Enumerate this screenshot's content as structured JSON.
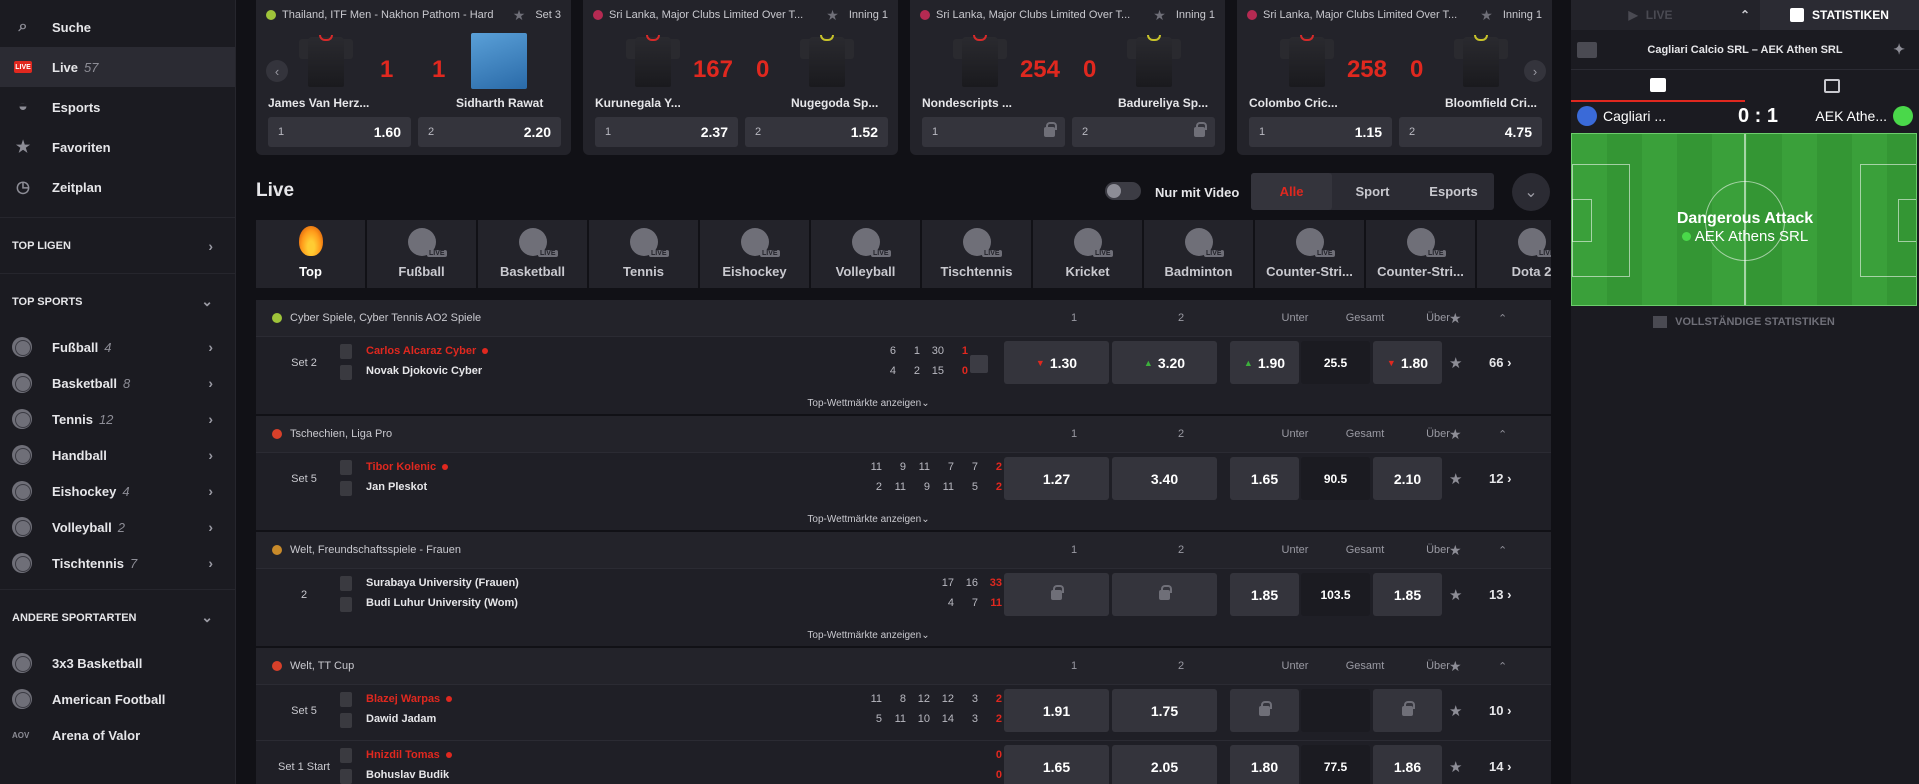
{
  "sidebar": {
    "main": [
      {
        "label": "Suche",
        "icon": "search-icon"
      },
      {
        "label": "Live",
        "count": "57",
        "icon": "live-icon",
        "badge": "LIVE"
      },
      {
        "label": "Esports",
        "icon": "gamepad-icon"
      },
      {
        "label": "Favoriten",
        "icon": "star-icon"
      },
      {
        "label": "Zeitplan",
        "icon": "clock-icon"
      }
    ],
    "top_ligen": "TOP LIGEN",
    "top_sports": "TOP SPORTS",
    "sports": [
      {
        "label": "Fußball",
        "count": "4"
      },
      {
        "label": "Basketball",
        "count": "8"
      },
      {
        "label": "Tennis",
        "count": "12"
      },
      {
        "label": "Handball",
        "count": ""
      },
      {
        "label": "Eishockey",
        "count": "4"
      },
      {
        "label": "Volleyball",
        "count": "2"
      },
      {
        "label": "Tischtennis",
        "count": "7"
      }
    ],
    "andere": "ANDERE SPORTARTEN",
    "other": [
      {
        "label": "3x3 Basketball"
      },
      {
        "label": "American Football"
      },
      {
        "label": "Arena of Valor",
        "icon_text": "AOV"
      }
    ]
  },
  "cards": [
    {
      "comp": "Thailand, ITF Men - Nakhon Pathom - Hard",
      "period": "Set 3",
      "s1": "1",
      "s2": "1",
      "t1": "James Van Herz...",
      "t2": "Sidharth Rawat",
      "o1": "1.60",
      "o2": "2.20",
      "l1": "1",
      "l2": "2"
    },
    {
      "comp": "Sri Lanka, Major Clubs Limited Over T...",
      "period": "Inning 1",
      "s1": "167",
      "s2": "0",
      "t1": "Kurunegala Y...",
      "t2": "Nugegoda Sp...",
      "o1": "2.37",
      "o2": "1.52",
      "l1": "1",
      "l2": "2"
    },
    {
      "comp": "Sri Lanka, Major Clubs Limited Over T...",
      "period": "Inning 1",
      "s1": "254",
      "s2": "0",
      "t1": "Nondescripts ...",
      "t2": "Badureliya Sp...",
      "o1": "",
      "o2": "",
      "l1": "1",
      "l2": "2"
    },
    {
      "comp": "Sri Lanka, Major Clubs Limited Over T...",
      "period": "Inning 1",
      "s1": "258",
      "s2": "0",
      "t1": "Colombo Cric...",
      "t2": "Bloomfield Cri...",
      "o1": "1.15",
      "o2": "4.75",
      "l1": "1",
      "l2": "2"
    }
  ],
  "live": {
    "title": "Live",
    "video_toggle": "Nur mit Video",
    "filters": [
      "Alle",
      "Sport",
      "Esports"
    ]
  },
  "sport_tabs": [
    "Top",
    "Fußball",
    "Basketball",
    "Tennis",
    "Eishockey",
    "Volleyball",
    "Tischtennis",
    "Kricket",
    "Badminton",
    "Counter-Stri...",
    "Counter-Stri...",
    "Dota 2"
  ],
  "live_badge": "LIVE",
  "cols": {
    "c1": "1",
    "c2": "2",
    "under": "Unter",
    "total": "Gesamt",
    "over": "Über"
  },
  "top_markets": "Top-Wettmärkte anzeigen",
  "groups": [
    {
      "title": "Cyber Spiele, Cyber Tennis AO2 Spiele",
      "rows": [
        {
          "set": "Set 2",
          "p1": "Carlos Alcaraz Cyber",
          "p2": "Novak Djokovic Cyber",
          "sc1": [
            "6",
            "1",
            "30",
            "1"
          ],
          "sc2": [
            "4",
            "2",
            "15",
            "0"
          ],
          "o1": "1.30",
          "o2": "3.20",
          "u": "1.90",
          "t": "25.5",
          "ov": "1.80",
          "more": "66"
        }
      ]
    },
    {
      "title": "Tschechien, Liga Pro",
      "rows": [
        {
          "set": "Set 5",
          "p1": "Tibor Kolenic",
          "p2": "Jan Pleskot",
          "sc1": [
            "11",
            "9",
            "11",
            "7",
            "7",
            "2"
          ],
          "sc2": [
            "2",
            "11",
            "9",
            "11",
            "5",
            "2"
          ],
          "o1": "1.27",
          "o2": "3.40",
          "u": "1.65",
          "t": "90.5",
          "ov": "2.10",
          "more": "12"
        }
      ]
    },
    {
      "title": "Welt, Freundschaftsspiele - Frauen",
      "rows": [
        {
          "set": "2",
          "p1": "Surabaya University (Frauen)",
          "p2": "Budi Luhur University (Wom)",
          "sc1": [
            "17",
            "16",
            "33"
          ],
          "sc2": [
            "4",
            "7",
            "11"
          ],
          "u": "1.85",
          "t": "103.5",
          "ov": "1.85",
          "more": "13"
        }
      ]
    },
    {
      "title": "Welt, TT Cup",
      "rows": [
        {
          "set": "Set 5",
          "p1": "Blazej Warpas",
          "p2": "Dawid Jadam",
          "sc1": [
            "11",
            "8",
            "12",
            "12",
            "3",
            "2"
          ],
          "sc2": [
            "5",
            "11",
            "10",
            "14",
            "3",
            "2"
          ],
          "o1": "1.91",
          "o2": "1.75",
          "more": "10"
        },
        {
          "set": "Set 1 Start",
          "p1": "Hnizdil Tomas",
          "p2": "Bohuslav Budik",
          "sc1": [
            "0"
          ],
          "sc2": [
            "0"
          ],
          "o1": "1.65",
          "o2": "2.05",
          "u": "1.80",
          "t": "77.5",
          "ov": "1.86",
          "more": "14"
        }
      ]
    }
  ],
  "right": {
    "tab_live": "LIVE",
    "tab_stats": "STATISTIKEN",
    "match": "Cagliari Calcio SRL – AEK Athen SRL",
    "home": "Cagliari ...",
    "score": "0 : 1",
    "away": "AEK Athe...",
    "event": "Dangerous Attack",
    "event_team": "AEK Athens SRL",
    "full_stats": "VOLLSTÄNDIGE STATISTIKEN"
  }
}
